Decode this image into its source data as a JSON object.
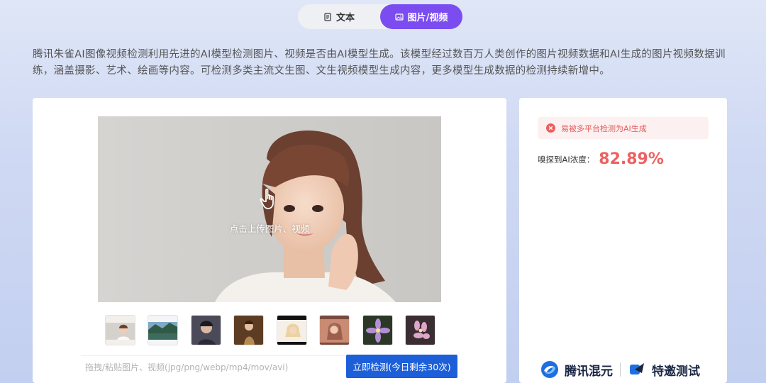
{
  "tabs": {
    "text_label": "文本",
    "image_label": "图片/视频",
    "active": "image"
  },
  "intro": "腾讯朱雀AI图像视频检测利用先进的AI模型检测图片、视频是否由AI模型生成。该模型经过数百万人类创作的图片视频数据和AI生成的图片视频数据训练，涵盖摄影、艺术、绘画等内容。可检测多类主流文生图、文生视频模型生成内容，更多模型生成数据的检测持续新增中。",
  "upload": {
    "hint": "点击上传图片、视频",
    "placeholder": "拖拽/粘贴图片、视频(jpg/png/webp/mp4/mov/avi)",
    "detect_button": "立即检测(今日剩余30次)"
  },
  "samples": [
    {
      "name": "sample-portrait-white"
    },
    {
      "name": "sample-lake"
    },
    {
      "name": "sample-person-dark"
    },
    {
      "name": "sample-woman-gold"
    },
    {
      "name": "sample-blonde"
    },
    {
      "name": "sample-woman-warm"
    },
    {
      "name": "sample-flower-purple"
    },
    {
      "name": "sample-flower-pink"
    }
  ],
  "result": {
    "alert": "易被多平台检测为AI生成",
    "score_label": "嗅探到AI浓度：",
    "score_value": "82.89%"
  },
  "brand": {
    "left": "腾讯混元",
    "right": "特邀测试"
  },
  "colors": {
    "accent": "#7b4df0",
    "button": "#1c5fd8",
    "alert_text": "#e25c5c",
    "score": "#ec6262"
  }
}
